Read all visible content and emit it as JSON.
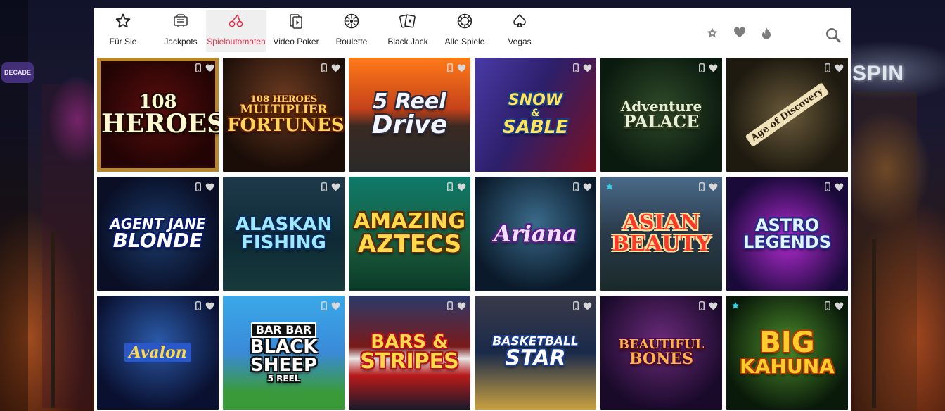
{
  "nav": {
    "items": [
      {
        "label": "Für Sie",
        "icon": "star-icon"
      },
      {
        "label": "Jackpots",
        "icon": "jackpot-icon"
      },
      {
        "label": "Spielautomaten",
        "icon": "cherries-icon",
        "active": true
      },
      {
        "label": "Video Poker",
        "icon": "video-poker-icon"
      },
      {
        "label": "Roulette",
        "icon": "roulette-icon"
      },
      {
        "label": "Black Jack",
        "icon": "cards-icon"
      },
      {
        "label": "Alle Spiele",
        "icon": "chip-icon"
      },
      {
        "label": "Vegas",
        "icon": "spade-icon"
      }
    ],
    "right_icons": [
      "sheriff-star-icon",
      "heart-icon",
      "flame-icon",
      "search-icon"
    ]
  },
  "colors": {
    "accent": "#e0304a"
  },
  "background": {
    "sign_text": "SPIN",
    "left_sign_text": "DECADE"
  },
  "games": [
    {
      "title_lines": [
        "108",
        "HEROES"
      ]
    },
    {
      "title_lines": [
        "108 HEROES",
        "MULTIPLIER",
        "FORTUNES"
      ]
    },
    {
      "title_lines": [
        "5 Reel",
        "Drive"
      ]
    },
    {
      "title_lines": [
        "SNOW",
        "&",
        "SABLE"
      ]
    },
    {
      "title_lines": [
        "Adventure",
        "PALACE"
      ]
    },
    {
      "title_lines": [
        "Age of Discovery"
      ]
    },
    {
      "title_lines": [
        "AGENT JANE",
        "BLONDE"
      ]
    },
    {
      "title_lines": [
        "ALASKAN",
        "FISHING"
      ]
    },
    {
      "title_lines": [
        "AMAZING",
        "AZTECS"
      ]
    },
    {
      "title_lines": [
        "Ariana"
      ]
    },
    {
      "title_lines": [
        "ASIAN",
        "BEAUTY"
      ]
    },
    {
      "title_lines": [
        "ASTRO",
        "LEGENDS"
      ]
    },
    {
      "title_lines": [
        "Avalon"
      ]
    },
    {
      "title_lines": [
        "BAR BAR",
        "BLACK",
        "SHEEP",
        "5 REEL"
      ]
    },
    {
      "title_lines": [
        "BARS &",
        "STRIPES"
      ]
    },
    {
      "title_lines": [
        "BASKETBALL",
        "STAR"
      ]
    },
    {
      "title_lines": [
        "BEAUTIFUL",
        "BONES"
      ]
    },
    {
      "title_lines": [
        "BIG",
        "KAHUNA"
      ]
    }
  ]
}
